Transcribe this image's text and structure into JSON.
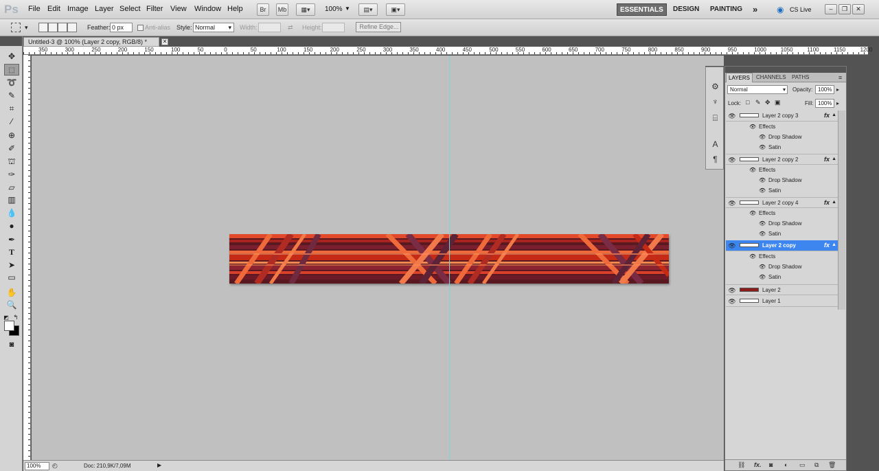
{
  "app": {
    "logo": "Ps",
    "menu": [
      "File",
      "Edit",
      "Image",
      "Layer",
      "Select",
      "Filter",
      "View",
      "Window",
      "Help"
    ],
    "bridge_btn": "Br",
    "minibridge_btn": "Mb",
    "zoom_menu": "100%",
    "workspaces": [
      "ESSENTIALS",
      "DESIGN",
      "PAINTING"
    ],
    "more_workspaces": "»",
    "cs_live": "CS Live",
    "win_minimize": "–",
    "win_restore": "❐",
    "win_close": "✕"
  },
  "options": {
    "feather_label": "Feather:",
    "feather_value": "0 px",
    "antialias_label": "Anti-alias",
    "style_label": "Style:",
    "style_value": "Normal",
    "width_label": "Width:",
    "height_label": "Height:",
    "refine_edge": "Refine Edge..."
  },
  "document": {
    "tab_title": "Untitled-3 @ 100% (Layer 2 copy, RGB/8) *",
    "tab_close": "✕",
    "ruler_ticks": [
      "350",
      "300",
      "250",
      "200",
      "150",
      "100",
      "50",
      "0",
      "50",
      "100",
      "150",
      "200",
      "250",
      "300",
      "350",
      "400",
      "450",
      "500",
      "550",
      "600",
      "650",
      "700",
      "750",
      "800",
      "850",
      "900",
      "950",
      "1000",
      "1050",
      "1100",
      "1150",
      "1200"
    ],
    "zoom": "100%",
    "doc_info": "Doc: 210,9K/7,09M"
  },
  "layers_panel": {
    "tabs": [
      "LAYERS",
      "CHANNELS",
      "PATHS"
    ],
    "blend_mode": "Normal",
    "opacity_label": "Opacity:",
    "opacity_value": "100%",
    "lock_label": "Lock:",
    "fill_label": "Fill:",
    "fill_value": "100%",
    "effects_label": "Effects",
    "drop_shadow_label": "Drop Shadow",
    "satin_label": "Satin",
    "fx_label": "fx",
    "layers": [
      {
        "name": "Layer 2 copy 3",
        "has_fx": true,
        "selected": false
      },
      {
        "name": "Layer 2 copy 2",
        "has_fx": true,
        "selected": false
      },
      {
        "name": "Layer 2 copy 4",
        "has_fx": true,
        "selected": false
      },
      {
        "name": "Layer 2 copy",
        "has_fx": true,
        "selected": true
      },
      {
        "name": "Layer 2",
        "has_fx": false,
        "selected": false
      },
      {
        "name": "Layer 1",
        "has_fx": false,
        "selected": false
      }
    ]
  },
  "colors": {
    "selection": "#3d86ef",
    "canvas_bg": "#c0c0c0",
    "guide": "#7fd3d3",
    "art_dark": "#4a1622",
    "art_red": "#c42a16",
    "art_orange": "#ef6a3b"
  }
}
